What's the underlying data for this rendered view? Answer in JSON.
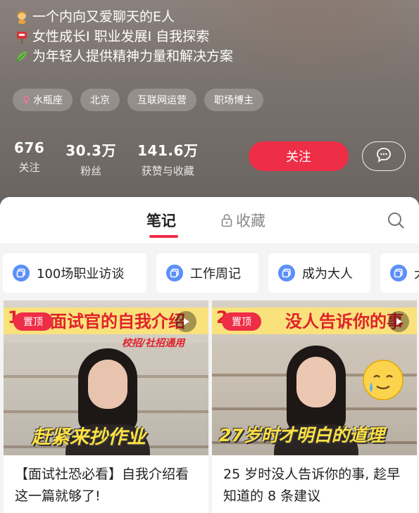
{
  "profile": {
    "bio": [
      {
        "icon": "person-emoji-icon",
        "text": "一个内向又爱聊天的E人"
      },
      {
        "icon": "mailbox-emoji-icon",
        "text": "女性成长I 职业发展I 自我探索"
      },
      {
        "icon": "leaf-emoji-icon",
        "text": "为年轻人提供精神力量和解决方案"
      }
    ],
    "tags": [
      "水瓶座",
      "北京",
      "互联网运营",
      "职场博主"
    ],
    "stats": [
      {
        "num": "676",
        "label": "关注"
      },
      {
        "num": "30.3万",
        "label": "粉丝"
      },
      {
        "num": "141.6万",
        "label": "获赞与收藏"
      }
    ],
    "follow_label": "关注"
  },
  "tabs": {
    "notes": "笔记",
    "favorites": "收藏"
  },
  "collections": [
    "100场职业访谈",
    "工作周记",
    "成为大人",
    "大"
  ],
  "notes": [
    {
      "pin": "置顶",
      "thumb_title": "面试官的自我介绍",
      "thumb_title_prefix": "1",
      "thumb_sub": "校招/社招通用",
      "thumb_bottom": "赶紧来抄作业",
      "title": "【面试社恐必看】自我介绍看这一篇就够了!"
    },
    {
      "pin": "置顶",
      "thumb_title": "没人告诉你的事",
      "thumb_title_prefix": "2",
      "thumb_bottom": "27岁时才明白的道理",
      "title": "25 岁时没人告诉你的事, 趁早知道的 8 条建议"
    }
  ],
  "colors": {
    "accent": "#ee2d46",
    "banner": "#f9e27b",
    "collection_icon": "#5b8ff9"
  }
}
